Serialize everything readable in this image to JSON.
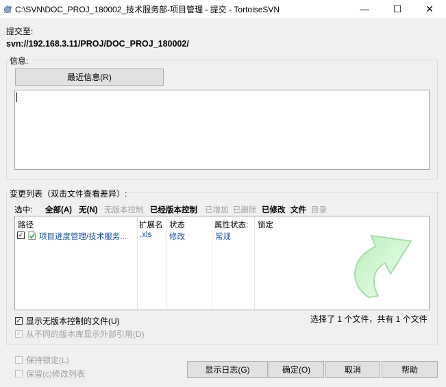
{
  "window": {
    "title": "C:\\SVN\\DOC_PROJ_180002_技术服务部-项目管理 - 提交 - TortoiseSVN",
    "minimize_glyph": "—",
    "maximize_glyph": "☐",
    "close_glyph": "✕"
  },
  "commit_to": {
    "label": "提交至:",
    "url": "svn://192.168.3.11/PROJ/DOC_PROJ_180002/"
  },
  "message": {
    "label": "信息:",
    "recent_button": "最近信息(R)",
    "value": ""
  },
  "changes": {
    "label": "变更列表（双击文件查看差异）:",
    "select_label": "选中:",
    "filters": {
      "all": "全部(A)",
      "none": "无(N)",
      "unversioned": "无版本控制",
      "versioned": "已经版本控制",
      "added": "已增加",
      "deleted": "已删除",
      "modified": "已修改",
      "files": "文件",
      "directories": "目录"
    },
    "columns": {
      "path": "路径",
      "extension": "扩展名",
      "status": "状态",
      "prop_status": "属性状态:",
      "lock": "锁定"
    },
    "rows": [
      {
        "checked": true,
        "path": "项目进度管理/技术服务...",
        "extension": ".xls",
        "status": "修改",
        "prop_status": "常规",
        "lock": ""
      }
    ],
    "summary": "选择了 1 个文件，共有 1 个文件"
  },
  "options": {
    "show_unversioned": "显示无版本控制的文件(U)",
    "show_externals": "从不同的版本库显示外部引用(D)",
    "keep_locks": "保持锁定(L)",
    "keep_changelists": "保留(c)修改列表"
  },
  "buttons": {
    "show_log": "显示日志(G)",
    "ok": "确定(O)",
    "cancel": "取消",
    "help": "帮助"
  },
  "colors": {
    "link_text": "#1a4fa0",
    "arrow_green": "#9be29b"
  }
}
